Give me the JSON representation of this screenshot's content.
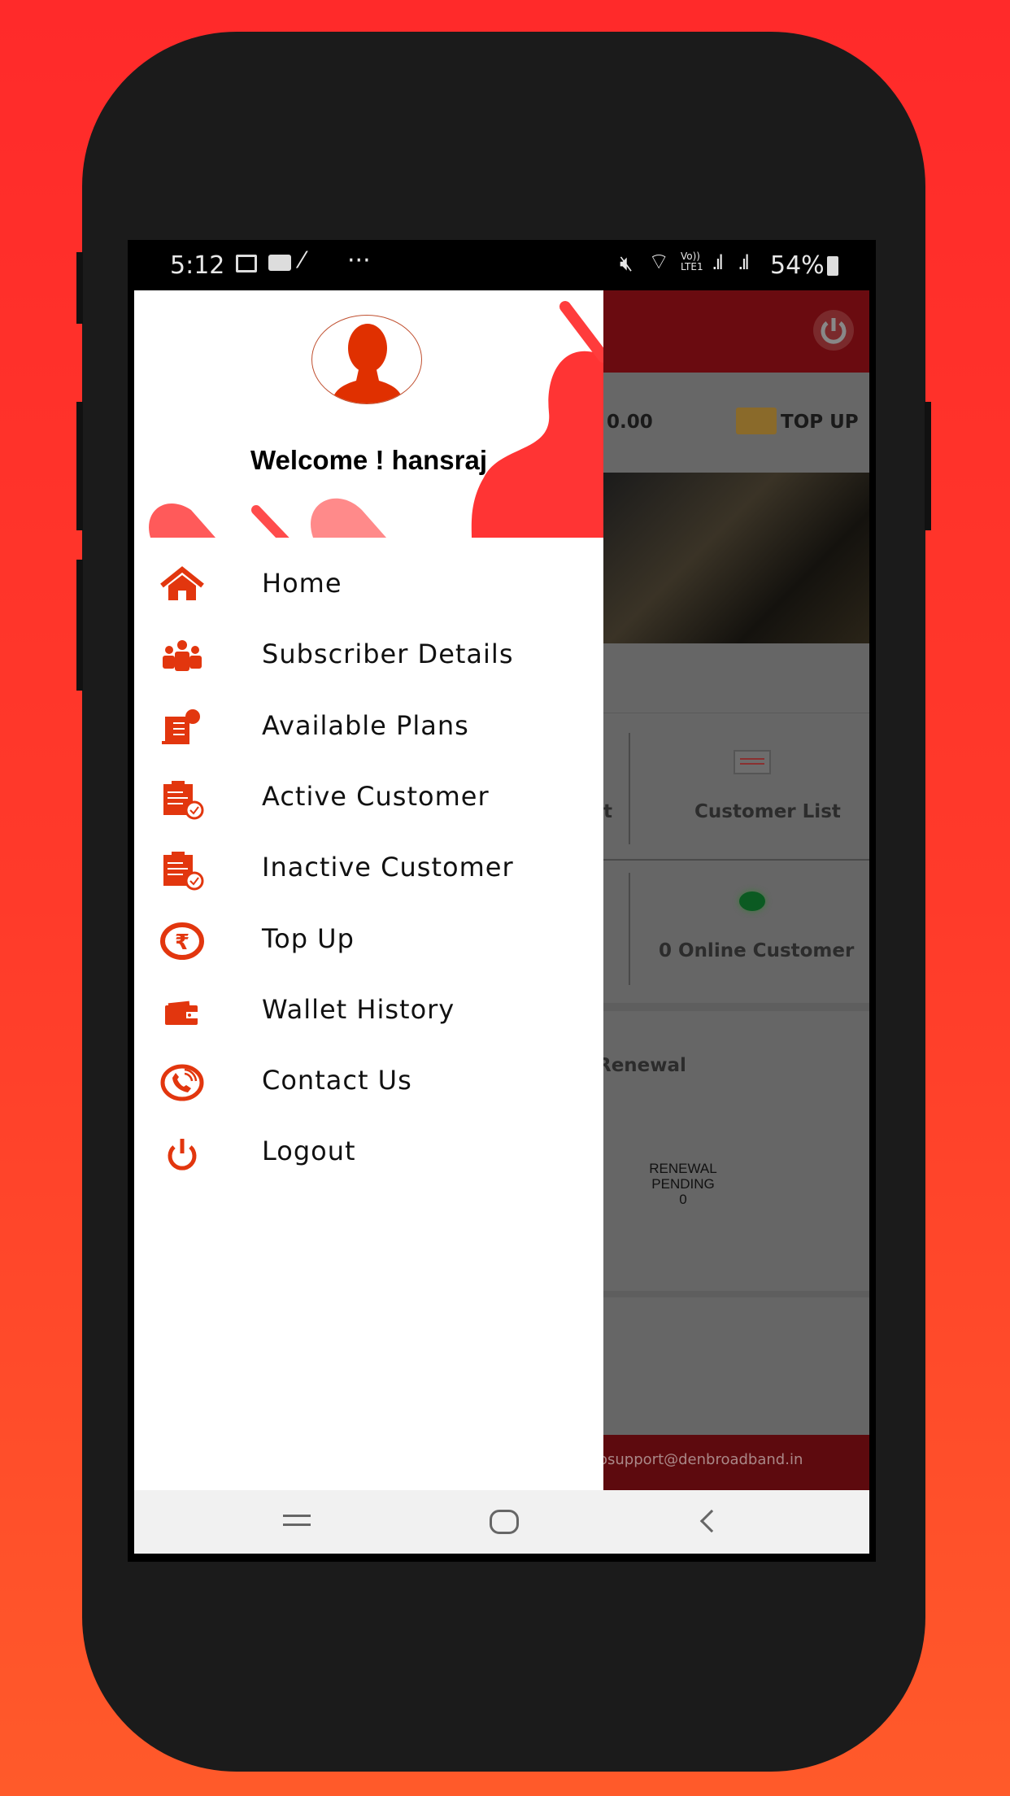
{
  "status_bar": {
    "time": "5:12",
    "battery": "54%",
    "icons": [
      "gallery-icon",
      "message-icon",
      "magic-wand-icon",
      "more-icon",
      "mute-icon",
      "wifi-icon",
      "volte-icon",
      "signal-icon",
      "signal-icon",
      "battery-charging-icon"
    ]
  },
  "drawer": {
    "welcome": "Welcome ! hansraj",
    "items": [
      {
        "label": "Home",
        "icon": "home-icon"
      },
      {
        "label": "Subscriber Details",
        "icon": "users-icon"
      },
      {
        "label": "Available Plans",
        "icon": "plans-icon"
      },
      {
        "label": "Active Customer",
        "icon": "clipboard-check-icon"
      },
      {
        "label": "Inactive Customer",
        "icon": "clipboard-check-icon"
      },
      {
        "label": "Top Up",
        "icon": "rupee-icon"
      },
      {
        "label": "Wallet History",
        "icon": "wallet-icon"
      },
      {
        "label": "Contact Us",
        "icon": "phone-icon"
      },
      {
        "label": "Logout",
        "icon": "power-icon"
      }
    ]
  },
  "background_app": {
    "balance": "0.00",
    "balance_partial": ".00",
    "top_up": "TOP UP",
    "tile_partial": "t",
    "customer_list": "Customer List",
    "online_customer": "0 Online Customer",
    "renewal_partial": "Renewal",
    "renewal_pending_label_1": "RENEWAL",
    "renewal_pending_label_2": "PENDING",
    "renewal_pending_count": "0",
    "footer_partial": "osupport@denbroadband.in"
  },
  "colors": {
    "accent": "#e2360e",
    "header_red": "#d01820",
    "online_green": "#1a9a3a"
  }
}
